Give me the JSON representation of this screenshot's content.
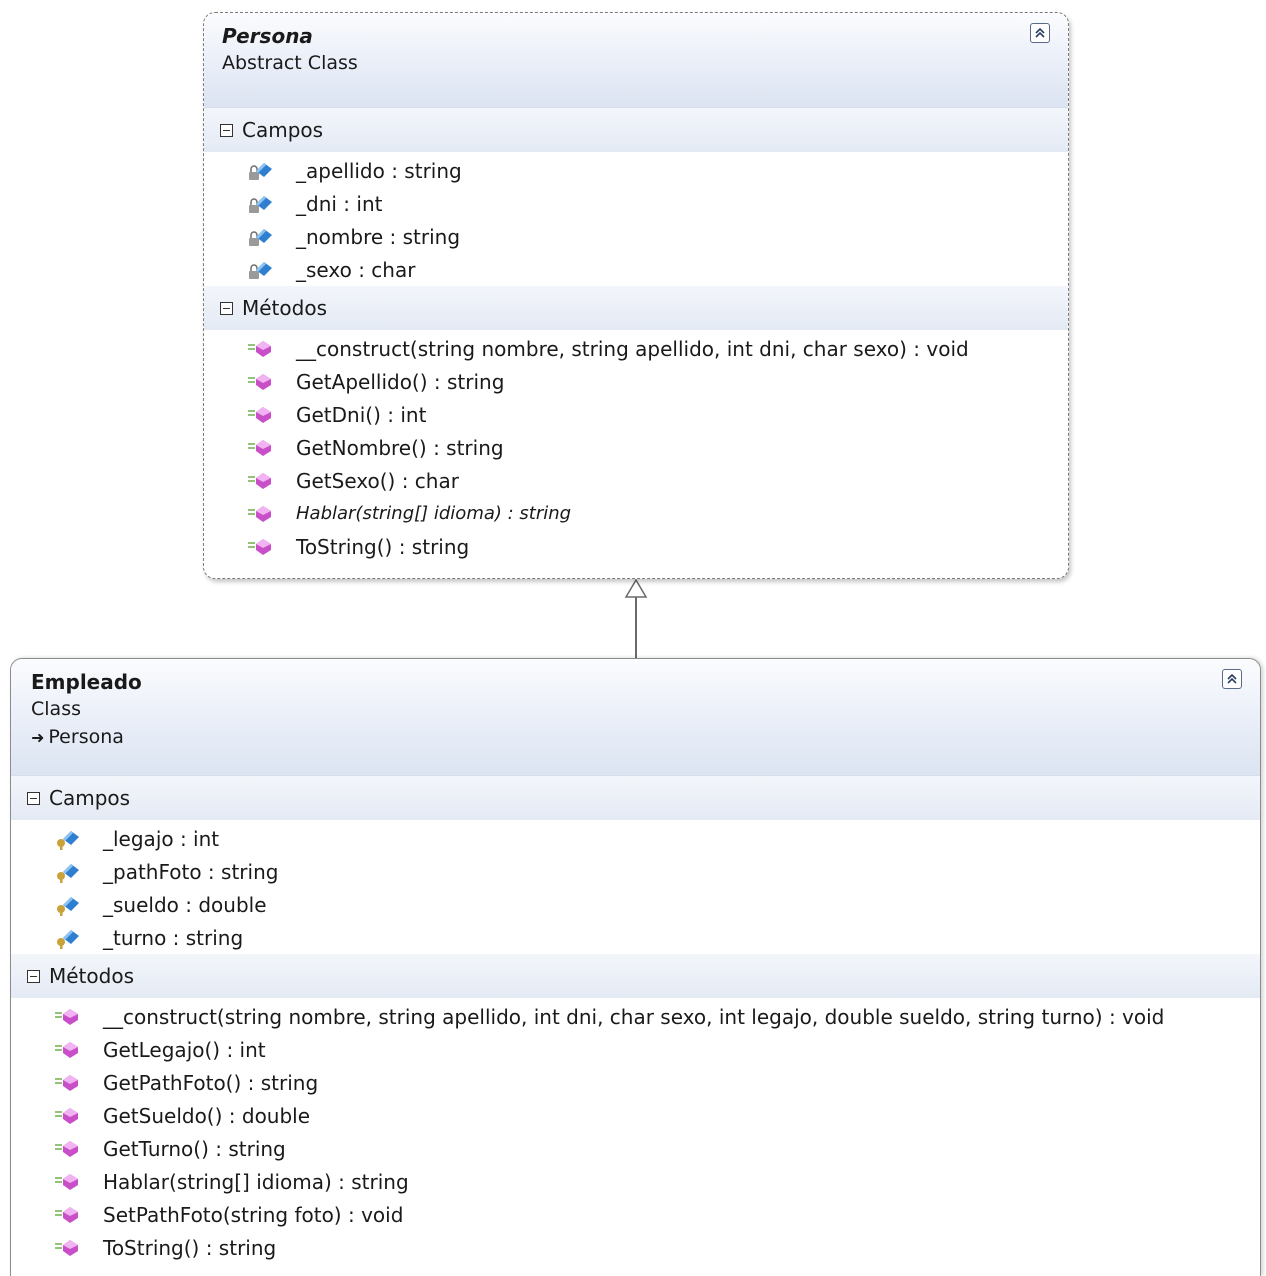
{
  "classes": [
    {
      "name": "Persona",
      "kind": "Abstract Class",
      "fields_header": "Campos",
      "methods_header": "Métodos",
      "fields": [
        "_apellido : string",
        "_dni : int",
        "_nombre : string",
        "_sexo : char"
      ],
      "methods": [
        "__construct(string nombre, string apellido, int dni, char sexo) : void",
        "GetApellido() : string",
        "GetDni() : int",
        "GetNombre() : string",
        "GetSexo() : char",
        "Hablar(string[] idioma) : string",
        "ToString() : string"
      ],
      "abstract_method_index": 5
    },
    {
      "name": "Empleado",
      "kind": "Class",
      "base": "Persona",
      "fields_header": "Campos",
      "methods_header": "Métodos",
      "fields": [
        "_legajo : int",
        "_pathFoto : string",
        "_sueldo : double",
        "_turno : string"
      ],
      "methods": [
        "__construct(string nombre, string apellido, int dni, char sexo, int legajo, double sueldo, string turno) : void",
        "GetLegajo() : int",
        "GetPathFoto() : string",
        "GetSueldo() : double",
        "GetTurno() : string",
        "Hablar(string[] idioma) : string",
        "SetPathFoto(string foto) : void",
        "ToString() : string"
      ]
    }
  ],
  "colors": {
    "field_icon": "#2f7fd1",
    "method_icon": "#c94fc9",
    "header_bg": "#e4eaf4",
    "protected_key": "#c9a23a"
  },
  "icons": {
    "field_private": "private-field-icon",
    "field_protected": "protected-field-icon",
    "method": "public-method-icon",
    "collapse": "collapse-chevron-icon",
    "inherits": "inheritance-arrow-icon"
  }
}
